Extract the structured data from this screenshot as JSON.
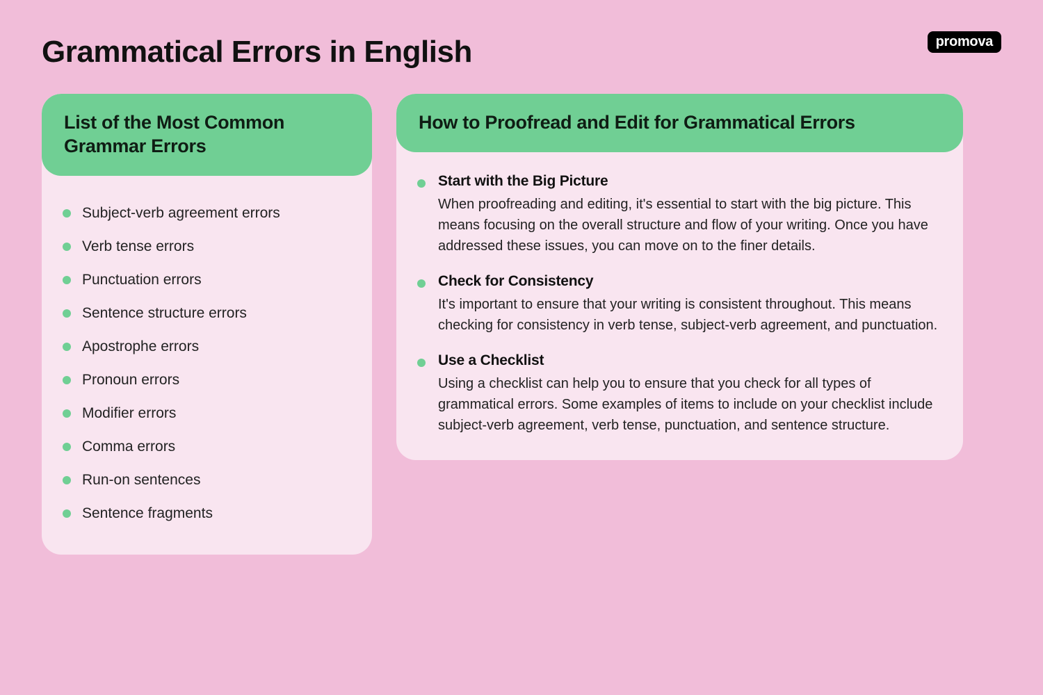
{
  "logo": "promova",
  "title": "Grammatical Errors in English",
  "left": {
    "heading": "List of the Most Common Grammar Errors",
    "items": [
      "Subject-verb agreement errors",
      "Verb tense errors",
      "Punctuation errors",
      "Sentence structure errors",
      "Apostrophe errors",
      "Pronoun errors",
      "Modifier errors",
      "Comma errors",
      "Run-on sentences",
      "Sentence fragments"
    ]
  },
  "right": {
    "heading": "How to Proofread and Edit for Grammatical Errors",
    "items": [
      {
        "title": "Start with the Big Picture",
        "desc": "When proofreading and editing, it's essential to start with the big picture. This means focusing on the overall structure and flow of your writing. Once you have addressed these issues, you can move on to the finer details."
      },
      {
        "title": "Check for Consistency",
        "desc": "It's important to ensure that your writing is consistent throughout. This means checking for consistency in verb tense, subject-verb agreement, and punctuation."
      },
      {
        "title": "Use a Checklist",
        "desc": "Using a checklist can help you to ensure that you check for all types of grammatical errors. Some examples of items to include on your checklist include subject-verb agreement, verb tense, punctuation, and sentence structure."
      }
    ]
  }
}
